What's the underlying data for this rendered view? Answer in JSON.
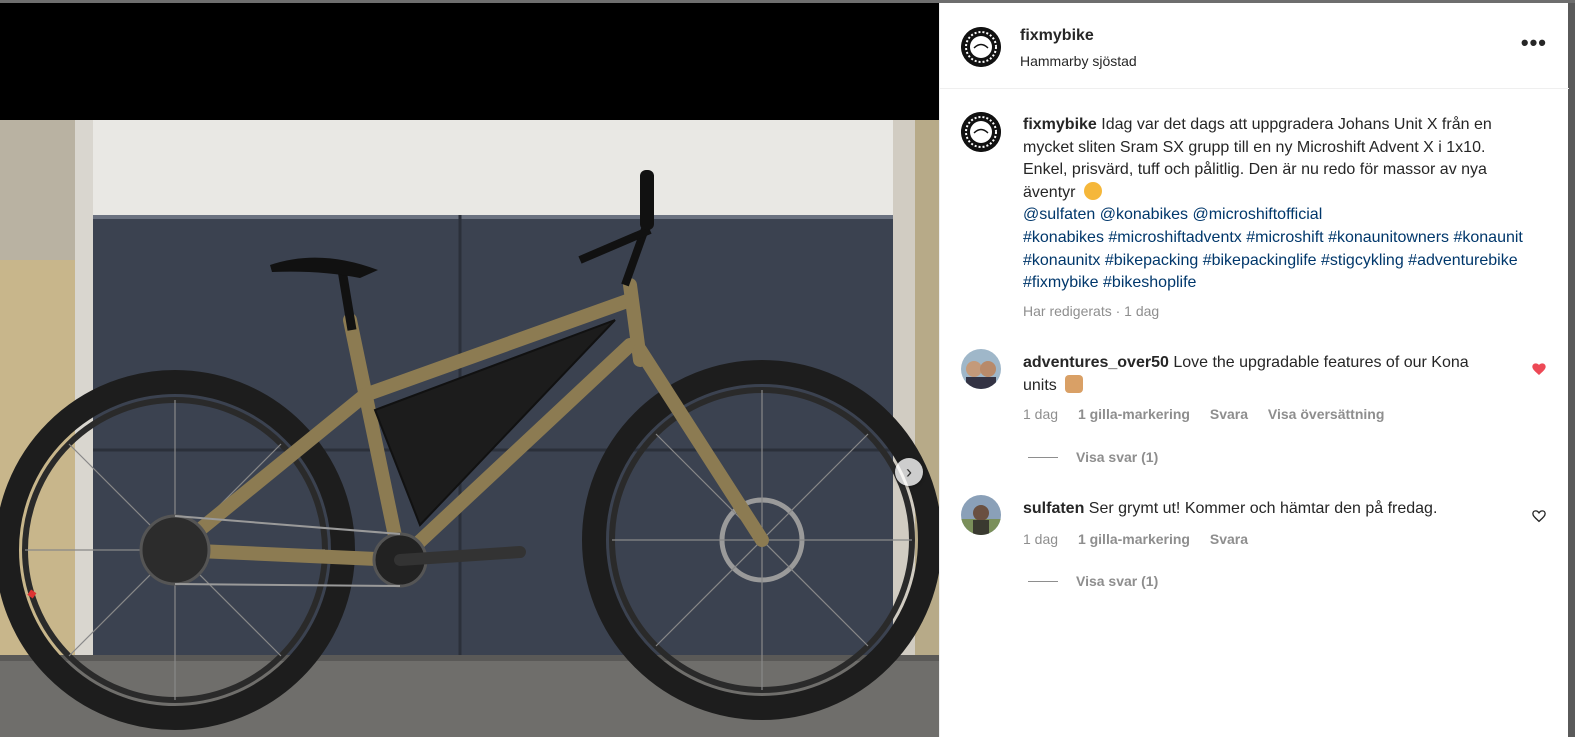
{
  "post": {
    "username": "fixmybike",
    "location": "Hammarby sjöstad",
    "more_label": "•••",
    "caption_user": "fixmybike",
    "caption_text": "Idag var det dags att uppgradera Johans Unit X från en mycket sliten Sram SX grupp till en ny Microshift Advent X i 1x10. Enkel, prisvärd, tuff och pålitlig. Den är nu redo för massor av nya äventyr",
    "mentions": [
      "@sulfaten",
      "@konabikes",
      "@microshiftofficial"
    ],
    "hashtags": [
      "#konabikes",
      "#microshiftadventx",
      "#microshift",
      "#konaunitowners",
      "#konaunit",
      "#konaunitx",
      "#bikepacking",
      "#bikepackinglife",
      "#stigcykling",
      "#adventurebike",
      "#fixmybike",
      "#bikeshoplife"
    ],
    "edited": "Har redigerats · 1 dag",
    "next_arrow": "›"
  },
  "comments": [
    {
      "username": "adventures_over50",
      "text": "Love the upgradable features of our Kona units",
      "time": "1 dag",
      "likes": "1 gilla-markering",
      "reply": "Svara",
      "translate": "Visa översättning",
      "view_replies": "Visa svar (1)",
      "liked": true
    },
    {
      "username": "sulfaten",
      "text": "Ser grymt ut! Kommer och hämtar den på fredag.",
      "time": "1 dag",
      "likes": "1 gilla-markering",
      "reply": "Svara",
      "view_replies": "Visa svar (1)",
      "liked": false
    }
  ],
  "colors": {
    "link": "#00376b",
    "secondary_text": "#8e8e8e",
    "like_red": "#ed4956"
  },
  "icons": {
    "more": "more-horizontal-icon",
    "next": "chevron-right-icon",
    "like": "heart-icon"
  }
}
